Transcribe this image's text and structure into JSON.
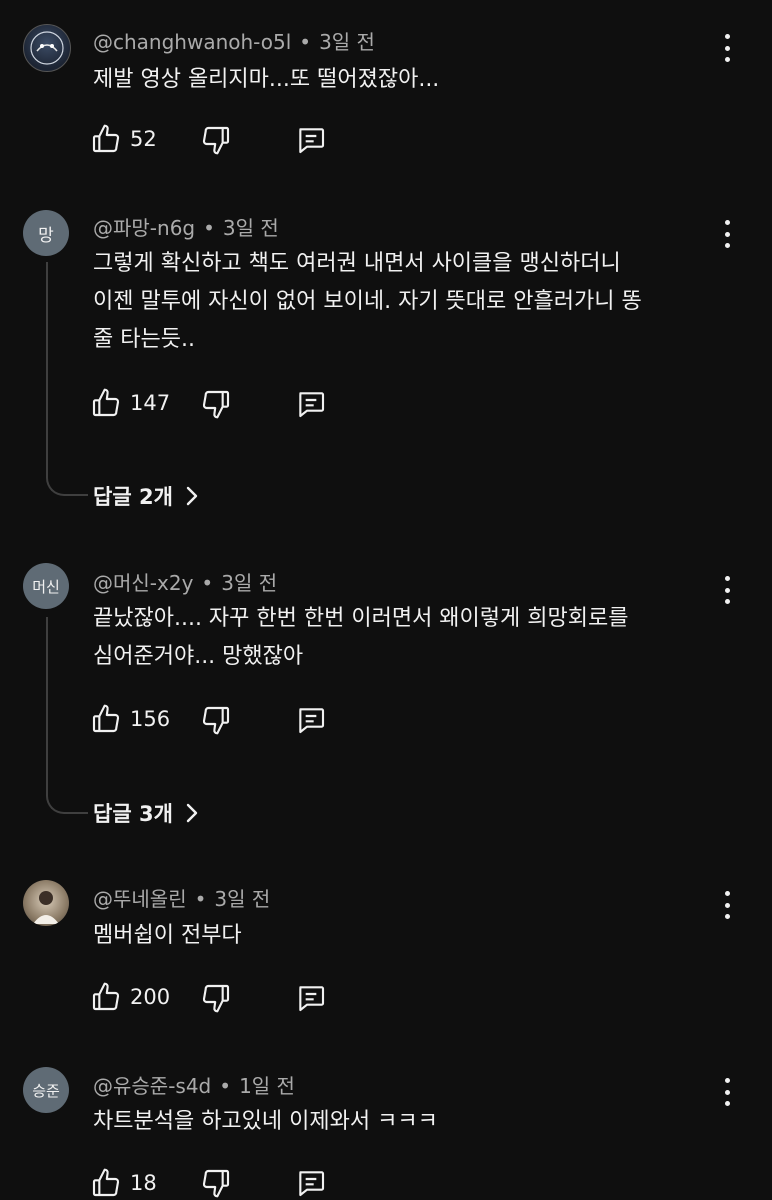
{
  "comments": [
    {
      "avatar_text": "",
      "author": "@changhwanoh-o5l",
      "time": "3일 전",
      "text_lines": [
        "제발 영상 올리지마...또 떨어졌잖아..."
      ],
      "likes": "52"
    },
    {
      "avatar_text": "망",
      "author": "@파망-n6g",
      "time": "3일 전",
      "text_lines": [
        "그렇게 확신하고 책도 여러권 내면서 사이클을 맹신하더니",
        "이젠 말투에 자신이 없어 보이네. 자기 뜻대로 안흘러가니 똥",
        "줄 타는듯.."
      ],
      "likes": "147",
      "replies_label": "답글 2개"
    },
    {
      "avatar_text": "머신",
      "author": "@머신-x2y",
      "time": "3일 전",
      "text_lines": [
        "끝났잖아.... 자꾸 한번 한번 이러면서 왜이렇게 희망회로를",
        "심어준거야... 망했잖아"
      ],
      "likes": "156",
      "replies_label": "답글 3개"
    },
    {
      "avatar_text": "",
      "author": "@뚜네올린",
      "time": "3일 전",
      "text_lines": [
        "멤버쉽이 전부다"
      ],
      "likes": "200"
    },
    {
      "avatar_text": "승준",
      "author": "@유승준-s4d",
      "time": "1일 전",
      "text_lines": [
        "차트분석을 하고있네 이제와서 ㅋㅋㅋ"
      ],
      "likes": "18"
    }
  ],
  "icons": {
    "like": "thumbs-up-icon",
    "dislike": "thumbs-down-icon",
    "reply": "comment-icon",
    "more": "more-vertical-icon",
    "chevron": "chevron-right-icon"
  }
}
